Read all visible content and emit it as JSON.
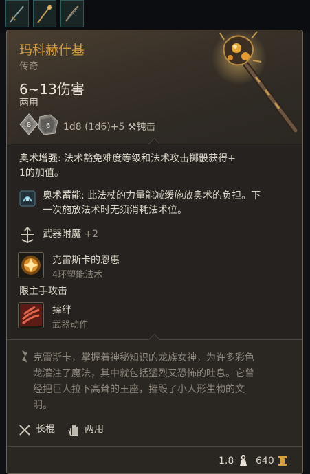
{
  "item": {
    "name": "玛科赫什基",
    "rarity": "传奇",
    "damage": "6~13伤害",
    "handedness": "两用",
    "dice_left": "8",
    "dice_right": "6",
    "dice_formula": "1d8 (1d6)+5",
    "damage_type": "钝击"
  },
  "effects": {
    "arcane_boost": {
      "label": "奥术增强:",
      "text_line1": " 法术豁免难度等级和法术攻击掷骰获得+",
      "text_line2": "1的加值。"
    },
    "arcane_reserve": {
      "label": "奥术蓄能:",
      "text_line1": " 此法杖的力量能减缓施放奥术的负担。下",
      "text_line2": "一次施放法术时无须消耗法术位。"
    },
    "enchant": {
      "label": "武器附魔",
      "value": "+2"
    },
    "spell": {
      "name": "克雷斯卡的恩惠",
      "sub": "4环塑能法术"
    },
    "mainhand_label": "限主手攻击",
    "action": {
      "name": "摔绊",
      "sub": "武器动作"
    }
  },
  "lore": {
    "line1": "克雷斯卡，掌握着神秘知识的龙族女神，为许多彩色",
    "line2": "龙灌注了魔法，其中就包括猛烈又恐怖的吐息。它曾",
    "line3": "经把巨人拉下高耸的王座，摧毁了小人形生物的文",
    "line4": "明。"
  },
  "tags": {
    "type": "长棍",
    "handedness": "两用"
  },
  "footer": {
    "weight": "1.8",
    "value": "640"
  },
  "icons": [
    "sword-slot-icon",
    "staff-slot-icon",
    "sling-slot-icon",
    "d8-die-icon",
    "d6-die-icon",
    "blunt-damage-icon",
    "arcane-reserve-icon",
    "enchant-icon",
    "spell-icon",
    "trip-action-icon",
    "lore-icon",
    "quarterstaff-icon",
    "two-hand-icon",
    "weight-icon",
    "gold-icon"
  ],
  "colors": {
    "title": "#d39c3c",
    "card_border": "#6d6457"
  }
}
